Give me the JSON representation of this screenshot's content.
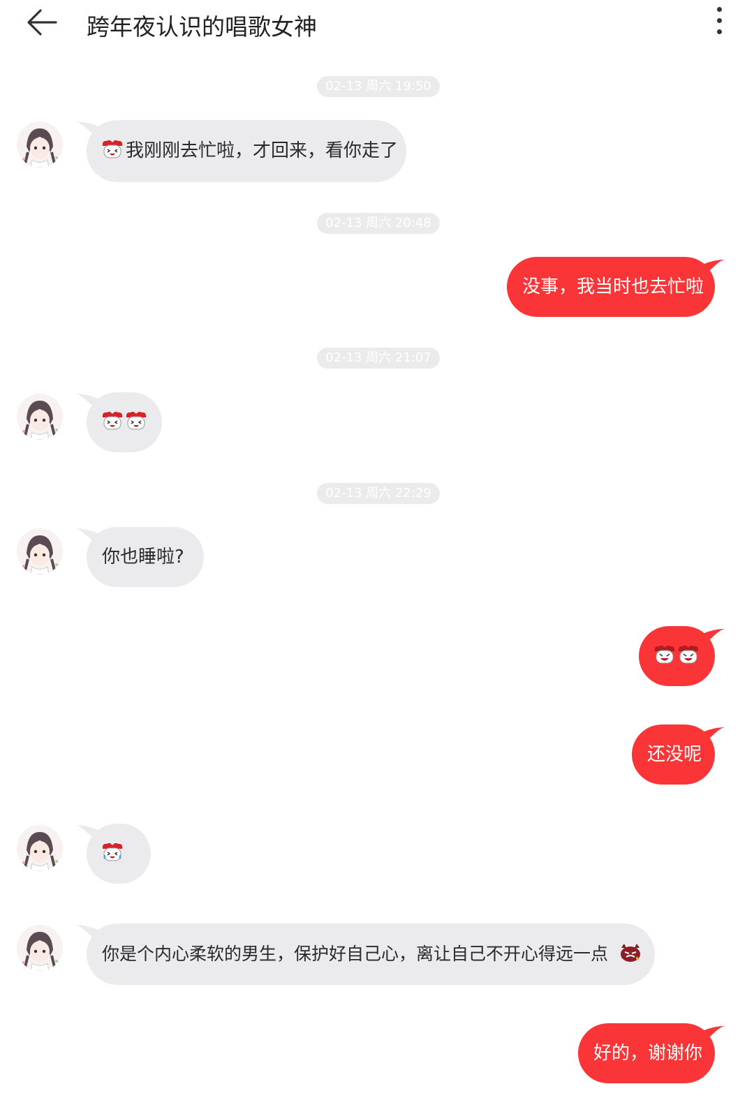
{
  "header": {
    "back_icon": "arrow-left-icon",
    "title": "跨年夜认识的唱歌女神",
    "more_icon": "more-vertical-icon"
  },
  "colors": {
    "incoming_bubble": "#ebebed",
    "outgoing_bubble": "#fa3537",
    "timestamp_pill": "#ebebeb"
  },
  "timestamps": [
    "02-13 周六 19:50",
    "02-13 周六 20:48",
    "02-13 周六 21:07",
    "02-13 周六 22:29"
  ],
  "messages": [
    {
      "side": "in",
      "text": "我刚刚去忙啦，才回来，看你走了",
      "emoji_prefix": "laughing-girl-emoji"
    },
    {
      "side": "out",
      "text": "没事，我当时也去忙啦"
    },
    {
      "side": "in",
      "text": "",
      "emojis": [
        "laughing-girl-emoji",
        "laughing-girl-emoji"
      ]
    },
    {
      "side": "in",
      "text": "你也睡啦?"
    },
    {
      "side": "out",
      "text": "",
      "emojis": [
        "grinning-girl-emoji",
        "grinning-girl-emoji"
      ]
    },
    {
      "side": "out",
      "text": "还没呢"
    },
    {
      "side": "in",
      "text": "",
      "emojis": [
        "crying-laughing-girl-emoji"
      ]
    },
    {
      "side": "in",
      "text": "你是个内心柔软的男生，保护好自己心，离让自己不开心得远一点",
      "emoji_suffix": "angry-devil-emoji"
    },
    {
      "side": "out",
      "text": "好的，谢谢你"
    }
  ]
}
